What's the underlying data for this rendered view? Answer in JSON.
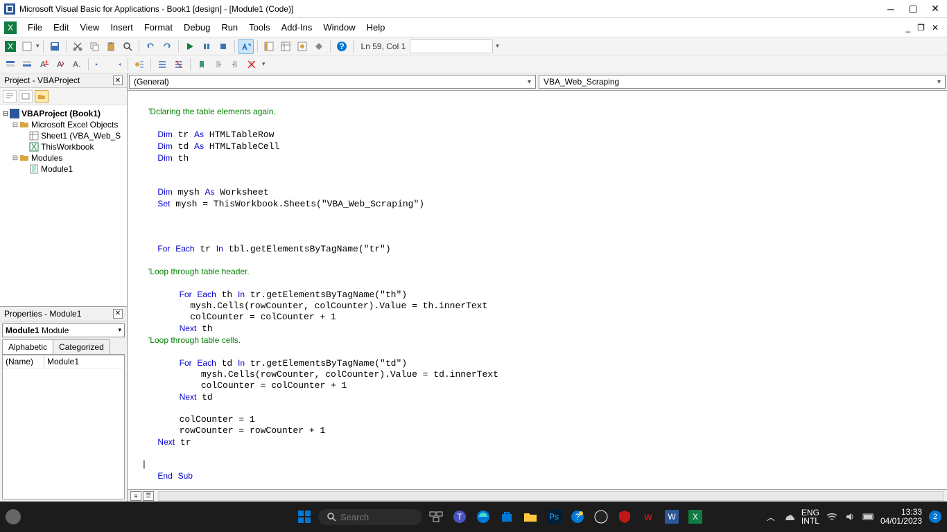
{
  "titlebar": {
    "title": "Microsoft Visual Basic for Applications - Book1 [design] - [Module1 (Code)]"
  },
  "menubar": {
    "items": [
      "File",
      "Edit",
      "View",
      "Insert",
      "Format",
      "Debug",
      "Run",
      "Tools",
      "Add-Ins",
      "Window",
      "Help"
    ]
  },
  "toolbar": {
    "status": "Ln 59, Col 1"
  },
  "project_panel": {
    "title": "Project - VBAProject",
    "tree": {
      "root": "VBAProject (Book1)",
      "excel_objects": "Microsoft Excel Objects",
      "sheet1": "Sheet1 (VBA_Web_S",
      "thisworkbook": "ThisWorkbook",
      "modules": "Modules",
      "module1": "Module1"
    }
  },
  "properties_panel": {
    "title": "Properties - Module1",
    "object_dd": "Module1 Module",
    "tabs": {
      "alpha": "Alphabetic",
      "cat": "Categorized"
    },
    "rows": [
      {
        "name": "(Name)",
        "value": "Module1"
      }
    ]
  },
  "code_dropdowns": {
    "left": "(General)",
    "right": "VBA_Web_Scraping"
  },
  "code_lines": [
    {
      "t": "",
      "c": ""
    },
    {
      "t": "   'Dclaring the table elements again.",
      "c": "cm"
    },
    {
      "t": "",
      "c": ""
    },
    {
      "t": "   Dim tr As HTMLTableRow",
      "c": "dim"
    },
    {
      "t": "   Dim td As HTMLTableCell",
      "c": "dim"
    },
    {
      "t": "   Dim th",
      "c": "dim1"
    },
    {
      "t": "",
      "c": ""
    },
    {
      "t": "",
      "c": ""
    },
    {
      "t": "   Dim mysh As Worksheet",
      "c": "dim"
    },
    {
      "t": "   Set mysh = ThisWorkbook.Sheets(\"VBA_Web_Scraping\")",
      "c": "set"
    },
    {
      "t": "",
      "c": ""
    },
    {
      "t": "",
      "c": ""
    },
    {
      "t": "",
      "c": ""
    },
    {
      "t": "   For Each tr In tbl.getElementsByTagName(\"tr\")",
      "c": "for"
    },
    {
      "t": "",
      "c": ""
    },
    {
      "t": "   'Loop through table header.",
      "c": "cm"
    },
    {
      "t": "",
      "c": ""
    },
    {
      "t": "       For Each th In tr.getElementsByTagName(\"th\")",
      "c": "for"
    },
    {
      "t": "         mysh.Cells(rowCounter, colCounter).Value = th.innerText",
      "c": ""
    },
    {
      "t": "         colCounter = colCounter + 1",
      "c": ""
    },
    {
      "t": "       Next th",
      "c": "next"
    },
    {
      "t": "   'Loop through table cells.",
      "c": "cm"
    },
    {
      "t": "",
      "c": ""
    },
    {
      "t": "       For Each td In tr.getElementsByTagName(\"td\")",
      "c": "for"
    },
    {
      "t": "           mysh.Cells(rowCounter, colCounter).Value = td.innerText",
      "c": ""
    },
    {
      "t": "           colCounter = colCounter + 1",
      "c": ""
    },
    {
      "t": "       Next td",
      "c": "next"
    },
    {
      "t": "",
      "c": ""
    },
    {
      "t": "       colCounter = 1",
      "c": ""
    },
    {
      "t": "       rowCounter = rowCounter + 1",
      "c": ""
    },
    {
      "t": "   Next tr",
      "c": "next"
    },
    {
      "t": "",
      "c": ""
    },
    {
      "t": "|",
      "c": ""
    },
    {
      "t": "   End Sub",
      "c": "end"
    }
  ],
  "taskbar": {
    "search_placeholder": "Search",
    "lang1": "ENG",
    "lang2": "INTL",
    "time": "13:33",
    "date": "04/01/2023",
    "notif": "2"
  }
}
